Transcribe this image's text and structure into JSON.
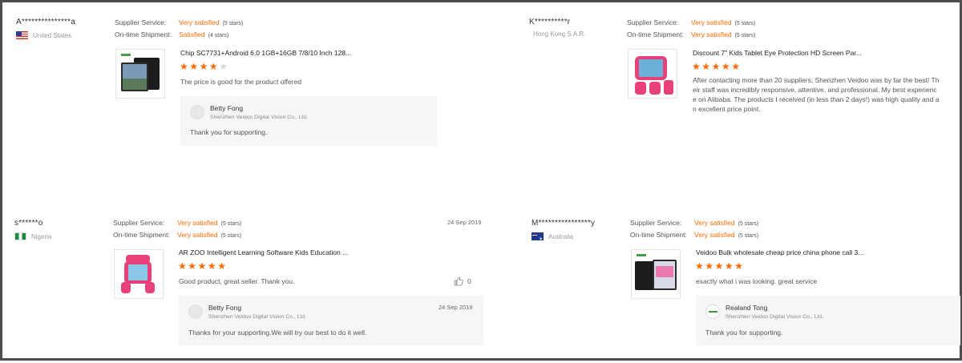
{
  "labels": {
    "supplier_service": "Supplier Service:",
    "on_time_shipment": "On-time Shipment:"
  },
  "colors": {
    "accent": "#ff6a00",
    "reply_bg": "#f6f6f6",
    "frame": "#4d4d4d"
  },
  "reviews": [
    {
      "buyer": "A***************a",
      "country": "United States",
      "flag_icon": "us-flag-icon",
      "supplier_service": "Very satisfied",
      "supplier_service_stars": "(5 stars)",
      "on_time_shipment": "Satisfied",
      "on_time_shipment_stars": "(4 stars)",
      "product_title": "Chip SC7731+Android 6.0 1GB+16GB 7/8/10 Inch 128...",
      "rating": 4,
      "comment": "The price is good for the product offered",
      "reply": {
        "name": "Betty Fong",
        "company": "Shenzhen Veidoo Digital Vision Co., Ltd.",
        "text": "Thank you for supporting."
      }
    },
    {
      "buyer": "K**********r",
      "country": "Hong Kong S.A.R.",
      "supplier_service": "Very satisfied",
      "supplier_service_stars": "(5 stars)",
      "on_time_shipment": "Very satisfied",
      "on_time_shipment_stars": "(5 stars)",
      "product_title": "Discount 7\" Kids Tablet Eye Protection HD Screen Par...",
      "rating": 5,
      "comment_lines": [
        "After contacting more than 20 suppliers, Shenzhen Veidoo was by far the best! Th",
        "eir staff was incredibly responsive, attentive, and professional. My best experienc",
        "e on Alibaba. The products I received (in less than 2 days!) was high quality and a",
        "n excellent price point."
      ]
    },
    {
      "buyer": "s******o",
      "country": "Nigeria",
      "flag_icon": "nigeria-flag-icon",
      "supplier_service": "Very satisfied",
      "supplier_service_stars": "(5 stars)",
      "on_time_shipment": "Very satisfied",
      "on_time_shipment_stars": "(5 stars)",
      "date": "24 Sep 2019",
      "product_title": "AR ZOO Intelligent Learning Software Kids Education ...",
      "rating": 5,
      "comment": "Good product, great seller. Thank you.",
      "helpful_count": "0",
      "reply": {
        "name": "Betty Fong",
        "company": "Shenzhen Veidoo Digital Vision Co., Ltd.",
        "date": "24 Sep 2019",
        "text": "Thanks for your supporting.We will try our best to do it well."
      }
    },
    {
      "buyer": "M****************y",
      "country": "Australia",
      "flag_icon": "australia-flag-icon",
      "supplier_service": "Very satisfied",
      "supplier_service_stars": "(5 stars)",
      "on_time_shipment": "Very satisfied",
      "on_time_shipment_stars": "(5 stars)",
      "product_title": "Veidoo Bulk wholesale cheap price china phone call 3...",
      "rating": 5,
      "comment": "exactly what i was looking. great service",
      "reply": {
        "name": "Realand Tong",
        "company": "Shenzhen Veidoo Digital Vision Co., Ltd.",
        "text": "Thank you for supporting."
      }
    }
  ]
}
